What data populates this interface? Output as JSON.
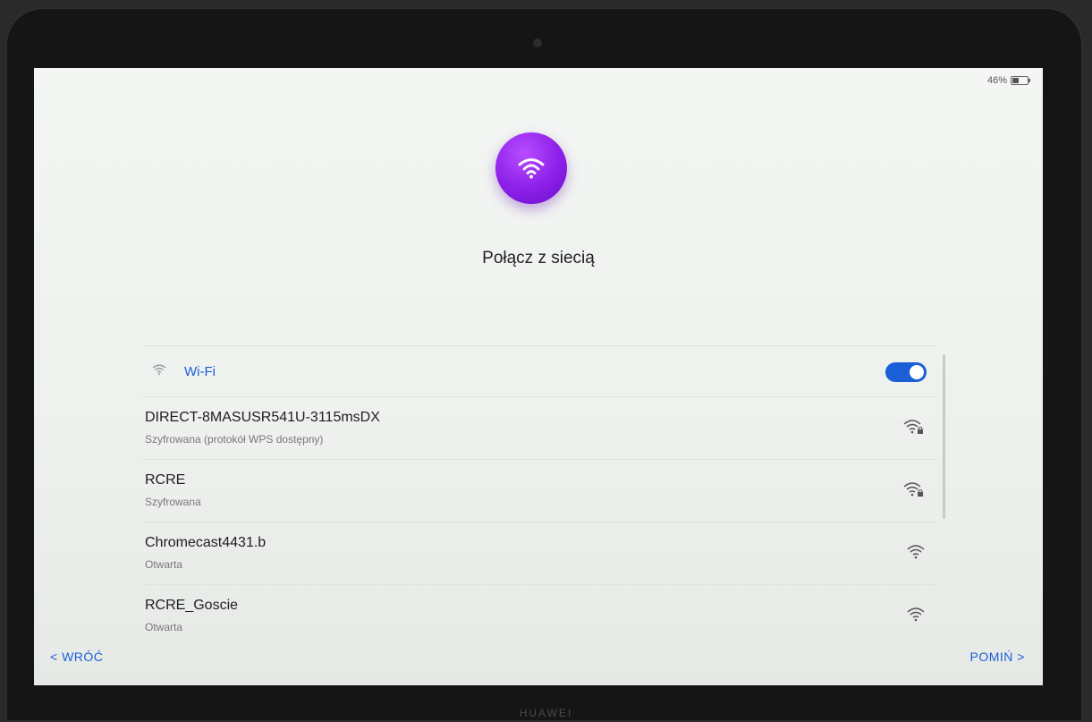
{
  "status": {
    "battery_percent": "46%",
    "battery_level": 0.46
  },
  "header": {
    "title": "Połącz z siecią",
    "accent_color": "#8c1fe8"
  },
  "wifi": {
    "label": "Wi-Fi",
    "enabled": true,
    "toggle_color": "#1a5fd6"
  },
  "networks": [
    {
      "name": "DIRECT-8MASUSR541U-3115msDX",
      "status": "Szyfrowana (protokół WPS dostępny)",
      "secured": true,
      "icon": "wifi-lock-icon"
    },
    {
      "name": "RCRE",
      "status": "Szyfrowana",
      "secured": true,
      "icon": "wifi-lock-icon"
    },
    {
      "name": "Chromecast4431.b",
      "status": "Otwarta",
      "secured": false,
      "icon": "wifi-icon"
    },
    {
      "name": "RCRE_Goscie",
      "status": "Otwarta",
      "secured": false,
      "icon": "wifi-icon"
    }
  ],
  "footer": {
    "back_label": "< WRÓĆ",
    "skip_label": "POMIŃ >"
  },
  "device": {
    "brand": "HUAWEI"
  }
}
